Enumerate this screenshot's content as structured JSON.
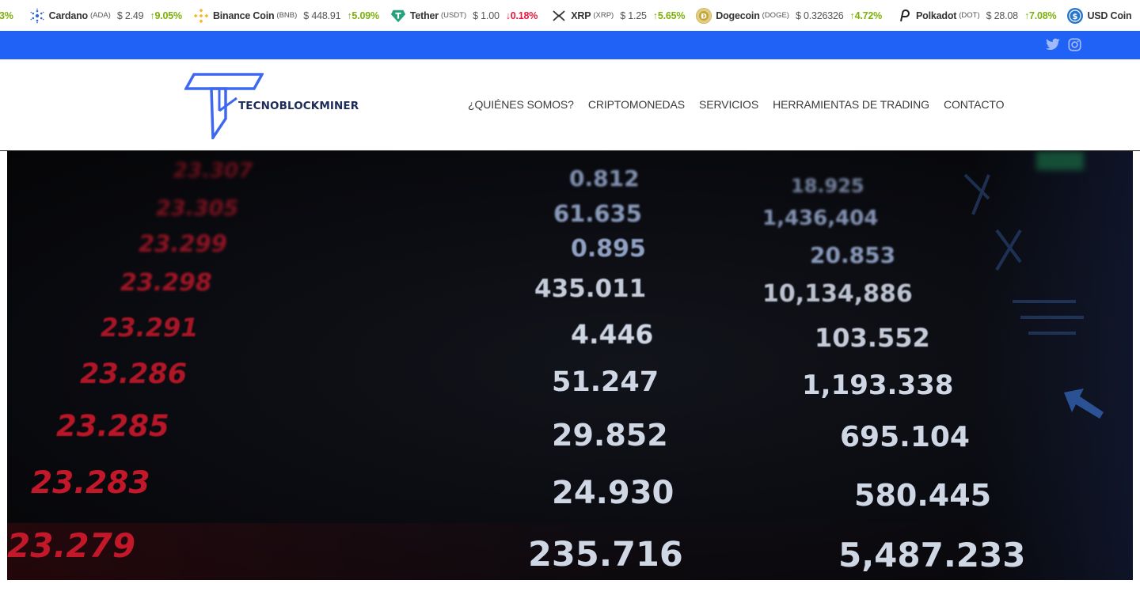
{
  "ticker": [
    {
      "name": "",
      "symbol": "",
      "price": "",
      "change": "3%",
      "dir": "up",
      "icon": "partial-coin-icon",
      "color": ""
    },
    {
      "name": "Cardano",
      "symbol": "(ADA)",
      "price": "$ 2.49",
      "change": "9.05%",
      "dir": "up",
      "icon": "cardano-icon",
      "color": "#ffffff"
    },
    {
      "name": "Binance Coin",
      "symbol": "(BNB)",
      "price": "$ 448.91",
      "change": "5.09%",
      "dir": "up",
      "icon": "binance-icon",
      "color": "#f3ba2f"
    },
    {
      "name": "Tether",
      "symbol": "(USDT)",
      "price": "$ 1.00",
      "change": "0.18%",
      "dir": "down",
      "icon": "tether-icon",
      "color": "#26a17b"
    },
    {
      "name": "XRP",
      "symbol": "(XRP)",
      "price": "$ 1.25",
      "change": "5.65%",
      "dir": "up",
      "icon": "xrp-icon",
      "color": "#ffffff"
    },
    {
      "name": "Dogecoin",
      "symbol": "(DOGE)",
      "price": "$ 0.326326",
      "change": "4.72%",
      "dir": "up",
      "icon": "dogecoin-icon",
      "color": "#c2a633"
    },
    {
      "name": "Polkadot",
      "symbol": "(DOT)",
      "price": "$ 28.08",
      "change": "7.08%",
      "dir": "up",
      "icon": "polkadot-icon",
      "color": "#ffffff"
    },
    {
      "name": "USD Coin",
      "symbol": "",
      "price": "",
      "change": "",
      "dir": "up",
      "icon": "usd-coin-icon",
      "color": "#2775ca"
    }
  ],
  "topbar": {
    "color": "#2162f6",
    "social": [
      "twitter-icon",
      "instagram-icon"
    ]
  },
  "header": {
    "logo_text": "TECNOBLOCKMINER",
    "nav": [
      "¿QUIÉNES SOMOS?",
      "CRIPTOMONEDAS",
      "SERVICIOS",
      "HERRAMIENTAS DE TRADING",
      "CONTACTO"
    ]
  },
  "hero": {
    "red_column": [
      "23.307",
      "23.305",
      "23.299",
      "23.298",
      "23.291",
      "23.286",
      "23.285",
      "23.283",
      "23.279"
    ],
    "middle_column": [
      "0.812",
      "61.635",
      "0.895",
      "435.011",
      "4.446",
      "51.247",
      "29.852",
      "24.930",
      "235.716"
    ],
    "right_column": [
      "18.925",
      "1,436,404",
      "20.853",
      "10,134,886",
      "103.552",
      "1,193.338",
      "695.104",
      "580.445",
      "5,487.233"
    ]
  }
}
